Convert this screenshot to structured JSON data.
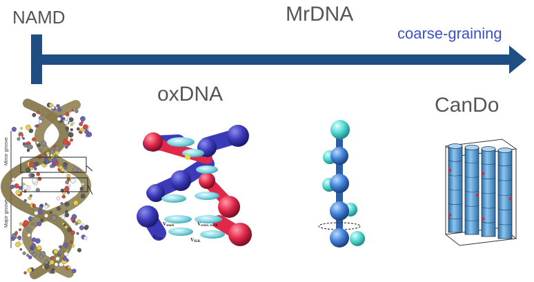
{
  "labels": {
    "namd": "NAMD",
    "mrdna": "MrDNA",
    "coarse_graining": "coarse-graining",
    "oxdna": "oxDNA",
    "cando": "CanDo"
  },
  "atomistic": {
    "groove_labels": [
      "Minor groove",
      "Major groove"
    ]
  },
  "oxdna_figure": {
    "terms": [
      "V",
      "stack",
      "V",
      "cross. stack",
      "V",
      "b.b.",
      "V",
      "H.B."
    ]
  },
  "colors": {
    "arrow": "#1f4e82",
    "coarse_graining_text": "#3a4fc4",
    "label_text": "#555555",
    "oxdna_backbone_blue": "#3b3ab8",
    "oxdna_backbone_red": "#e0284a",
    "oxdna_base": "#7fd6e0",
    "mrdna_bead": "#3f7fd6",
    "mrdna_bead_cyan": "#4fd6d0",
    "cando_cylinder": "#5fa2d8"
  }
}
